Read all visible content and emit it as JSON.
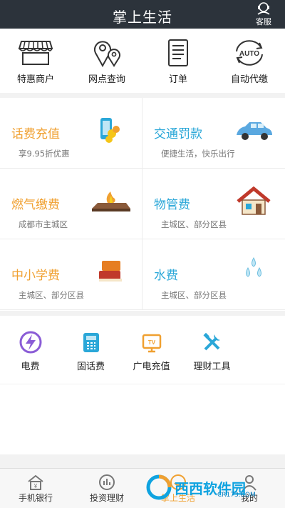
{
  "header": {
    "title": "掌上生活",
    "service_label": "客服"
  },
  "quick_actions": [
    {
      "label": "特惠商户",
      "icon": "storefront-icon"
    },
    {
      "label": "网点查询",
      "icon": "location-pin-icon"
    },
    {
      "label": "订单",
      "icon": "document-icon"
    },
    {
      "label": "自动代缴",
      "icon": "auto-renew-icon"
    }
  ],
  "tiles": [
    {
      "title": "话费充值",
      "subtitle": "享9.95折优惠",
      "color": "#f0a030",
      "icon": "phone-coins-icon"
    },
    {
      "title": "交通罚款",
      "subtitle": "便捷生活，快乐出行",
      "color": "#2aa7d8",
      "icon": "car-icon"
    },
    {
      "title": "燃气缴费",
      "subtitle": "成都市主城区",
      "color": "#f0a030",
      "icon": "gas-stove-icon"
    },
    {
      "title": "物管费",
      "subtitle": "主城区、部分区县",
      "color": "#2aa7d8",
      "icon": "house-icon"
    },
    {
      "title": "中小学费",
      "subtitle": "主城区、部分区县",
      "color": "#f0a030",
      "icon": "books-icon"
    },
    {
      "title": "水费",
      "subtitle": "主城区、部分区县",
      "color": "#2aa7d8",
      "icon": "water-drops-icon"
    }
  ],
  "services": [
    {
      "label": "电费",
      "icon": "lightning-icon",
      "color": "#8a5cd6"
    },
    {
      "label": "固话费",
      "icon": "telephone-icon",
      "color": "#2aa7d8"
    },
    {
      "label": "广电充值",
      "icon": "tv-icon",
      "color": "#f0a030"
    },
    {
      "label": "理财工具",
      "icon": "tools-icon",
      "color": "#2aa7d8"
    }
  ],
  "tabbar": [
    {
      "label": "手机银行",
      "icon": "bank-icon",
      "active": false
    },
    {
      "label": "投资理财",
      "icon": "chart-icon",
      "active": false
    },
    {
      "label": "掌上生活",
      "icon": "life-icon",
      "active": true
    },
    {
      "label": "我的",
      "icon": "user-icon",
      "active": false
    }
  ],
  "watermark": {
    "brand": "西西软件园",
    "url": "CR173.COM"
  }
}
